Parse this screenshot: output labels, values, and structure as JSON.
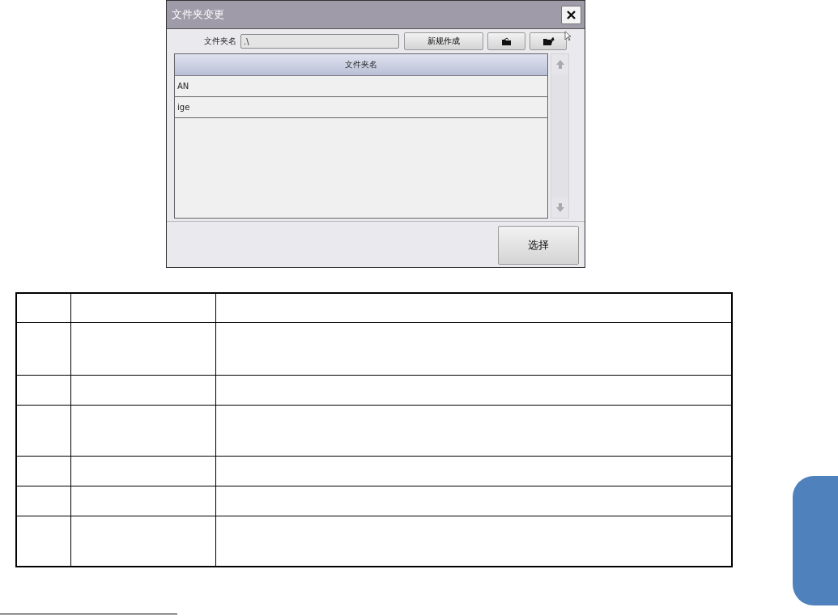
{
  "dialog": {
    "title": "文件夹变更",
    "folder_field": {
      "label": "文件夹名",
      "value": ".\\"
    },
    "new_button": "新规作成",
    "list": {
      "column": "文件夹名",
      "rows": [
        {
          "name": "AN"
        },
        {
          "name": "ige"
        }
      ]
    },
    "select_button": "选择"
  }
}
